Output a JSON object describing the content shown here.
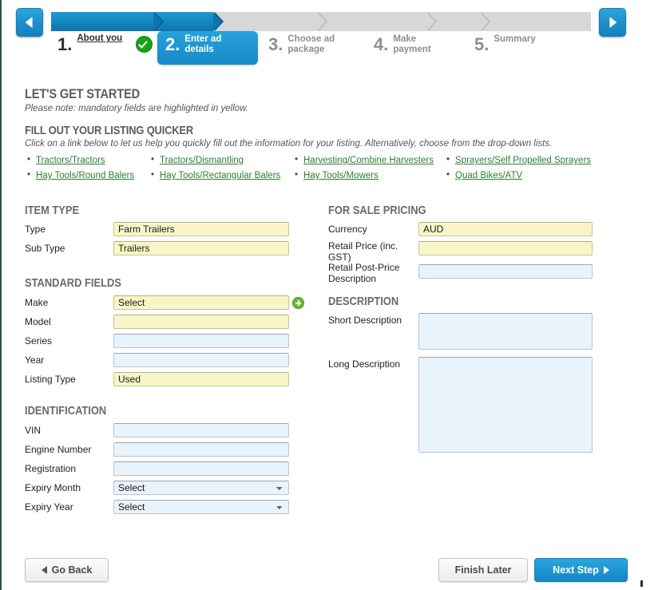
{
  "wizard": {
    "prev_arrow": "prev-arrow",
    "next_arrow": "next-arrow",
    "steps": [
      {
        "num": "1.",
        "label": "About you",
        "state": "done"
      },
      {
        "num": "2.",
        "label": "Enter ad details",
        "state": "active"
      },
      {
        "num": "3.",
        "label": "Choose ad package",
        "state": "inactive"
      },
      {
        "num": "4.",
        "label": "Make payment",
        "state": "inactive"
      },
      {
        "num": "5.",
        "label": "Summary",
        "state": "inactive"
      }
    ]
  },
  "intro": {
    "heading": "LET'S GET STARTED",
    "note": "Please note: mandatory fields are highlighted in yellow.",
    "quicker_heading": "FILL OUT YOUR LISTING QUICKER",
    "quicker_note": "Click on a link below to let us help you quickly fill out the information for your listing. Alternatively, choose from the drop-down lists.",
    "links": [
      "Tractors/Tractors",
      "Tractors/Dismantling",
      "Harvesting/Combine Harvesters",
      "Sprayers/Self Propelled Sprayers",
      "Hay Tools/Round Balers",
      "Hay Tools/Rectangular Balers",
      "Hay Tools/Mowers",
      "Quad Bikes/ATV"
    ]
  },
  "item_type": {
    "heading": "ITEM TYPE",
    "type_label": "Type",
    "type_value": "Farm Trailers",
    "subtype_label": "Sub Type",
    "subtype_value": "Trailers"
  },
  "standard_fields": {
    "heading": "STANDARD FIELDS",
    "make_label": "Make",
    "make_value": "Select",
    "add_make_icon": "plus-icon",
    "model_label": "Model",
    "model_value": "",
    "series_label": "Series",
    "series_value": "",
    "year_label": "Year",
    "year_value": "",
    "listing_type_label": "Listing Type",
    "listing_type_value": "Used"
  },
  "identification": {
    "heading": "IDENTIFICATION",
    "vin_label": "VIN",
    "vin_value": "",
    "engine_label": "Engine Number",
    "engine_value": "",
    "registration_label": "Registration",
    "registration_value": "",
    "expiry_month_label": "Expiry Month",
    "expiry_month_value": "Select",
    "expiry_year_label": "Expiry Year",
    "expiry_year_value": "Select"
  },
  "pricing": {
    "heading": "FOR SALE PRICING",
    "currency_label": "Currency",
    "currency_value": "AUD",
    "retail_price_label": "Retail Price (inc. GST)",
    "retail_price_value": "",
    "post_price_label": "Retail Post-Price Description",
    "post_price_value": ""
  },
  "description": {
    "heading": "DESCRIPTION",
    "short_label": "Short Description",
    "short_value": "",
    "long_label": "Long Description",
    "long_value": ""
  },
  "footer": {
    "go_back": "Go Back",
    "finish_later": "Finish Later",
    "next_step": "Next Step"
  },
  "colors": {
    "accent_blue": "#1d9ad4",
    "mandatory_yellow": "#f8f6c8",
    "optional_blue": "#e9f3fb",
    "link_green": "#2e7d32",
    "check_green": "#18a21a"
  }
}
